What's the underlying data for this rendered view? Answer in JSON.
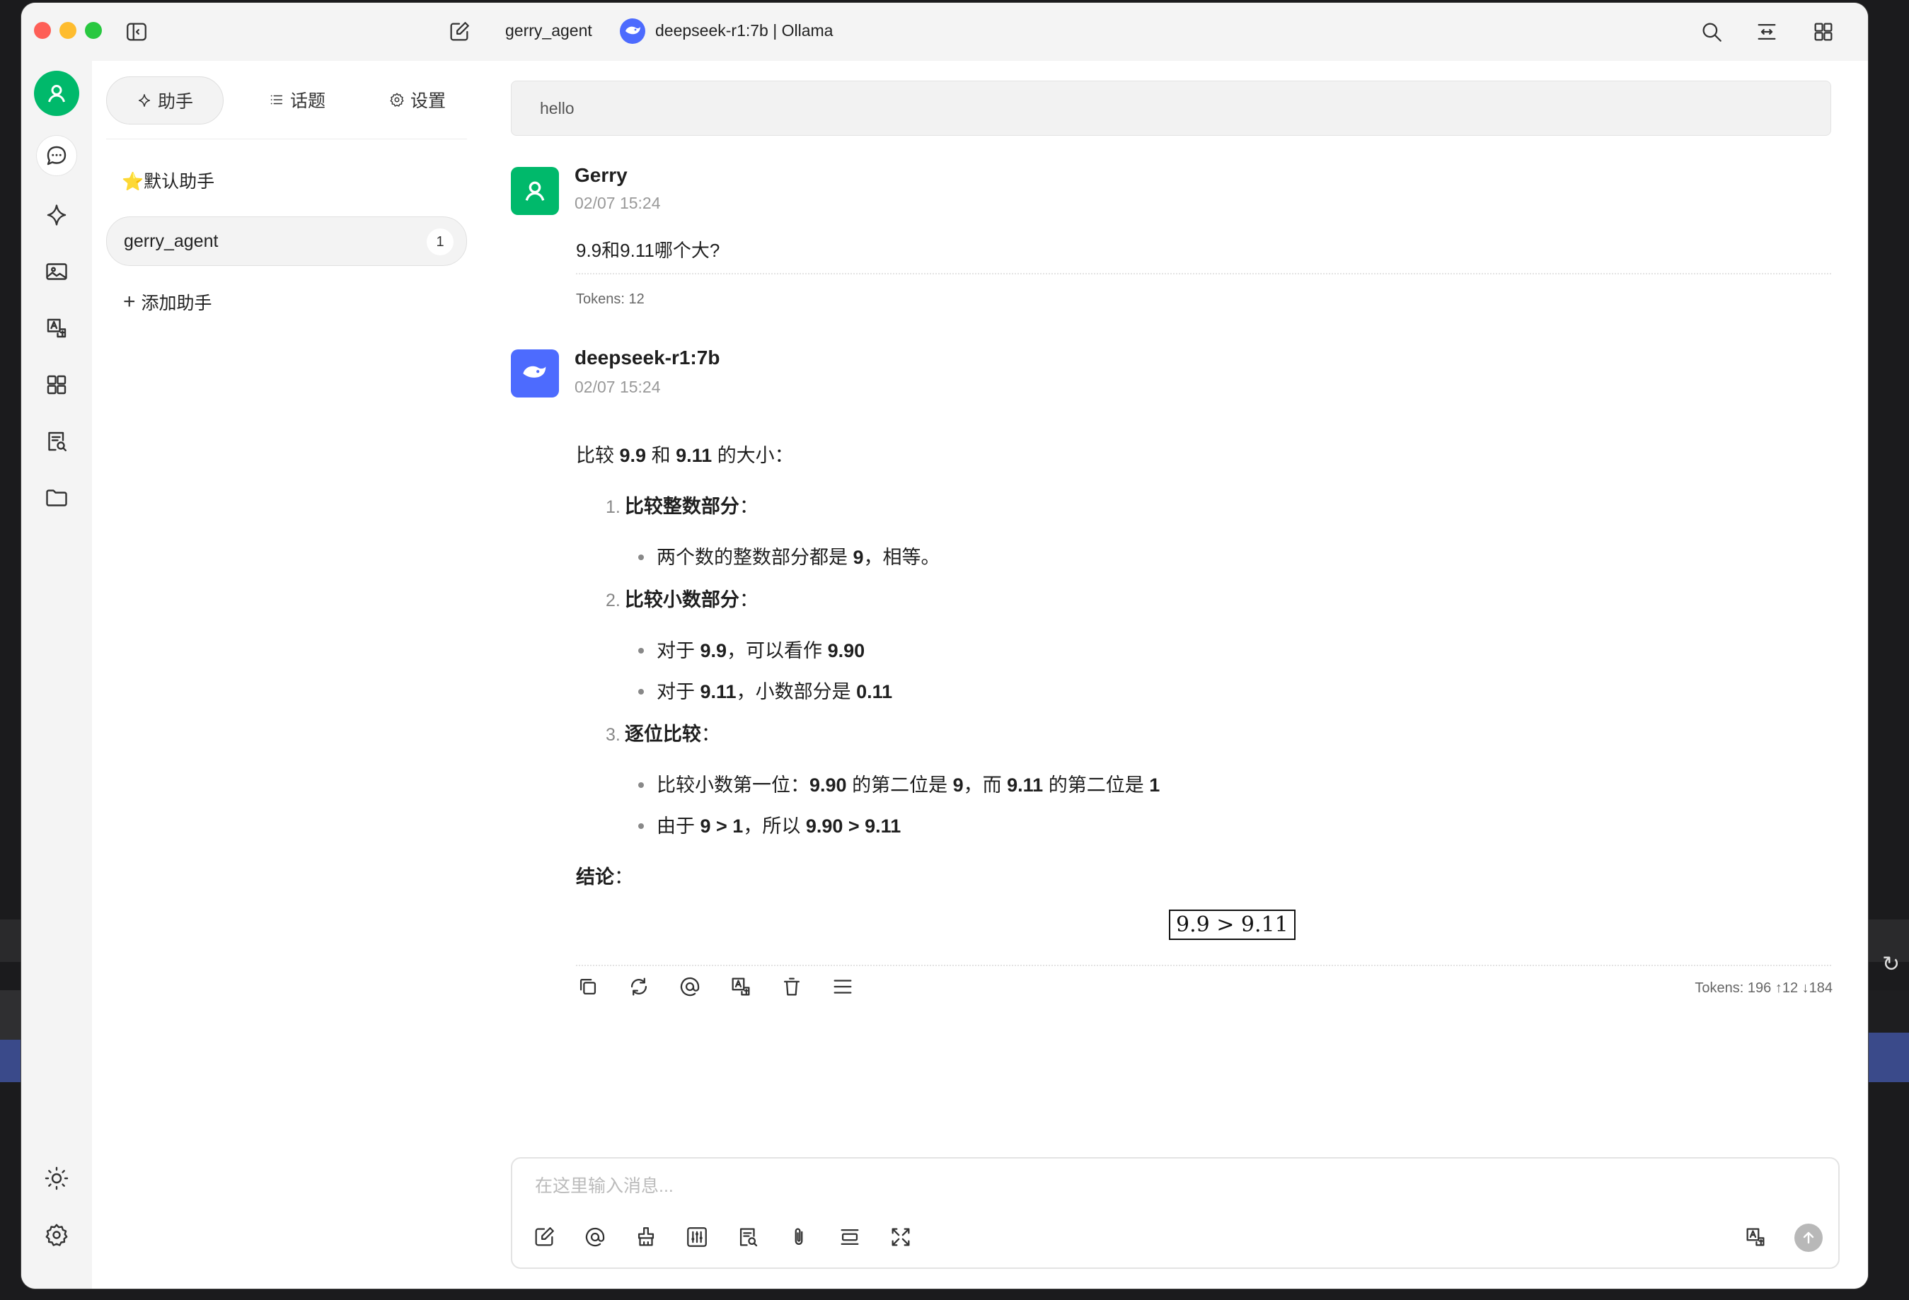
{
  "window": {
    "agent_title": "gerry_agent",
    "model_label": "deepseek-r1:7b | Ollama"
  },
  "left_panel": {
    "tabs": [
      {
        "label": "助手"
      },
      {
        "label": "话题"
      },
      {
        "label": "设置"
      }
    ],
    "assistants": [
      {
        "label": "⭐️默认助手"
      },
      {
        "label": "gerry_agent",
        "count": "1"
      }
    ],
    "add_assistant": "添加助手"
  },
  "chat": {
    "topic": "hello",
    "user_message": {
      "name": "Gerry",
      "time": "02/07 15:24",
      "text": "9.9和9.11哪个大?",
      "tokens": "Tokens: 12"
    },
    "assistant_message": {
      "name": "deepseek-r1:7b",
      "time": "02/07 15:24",
      "intro_pre": "比较 ",
      "intro_a": "9.9",
      "intro_mid": " 和 ",
      "intro_b": "9.11",
      "intro_post": " 的大小：",
      "steps": [
        {
          "num": "1.",
          "title": "比较整数部分",
          "suffix": "："
        },
        {
          "num": "2.",
          "title": "比较小数部分",
          "suffix": "："
        },
        {
          "num": "3.",
          "title": "逐位比较",
          "suffix": "："
        }
      ],
      "step1_bullet": {
        "pre": "两个数的整数部分都是 ",
        "b1": "9",
        "post": "，相等。"
      },
      "step2_bullets": [
        {
          "pre": "对于 ",
          "b1": "9.9",
          "mid": "，可以看作 ",
          "b2": "9.90"
        },
        {
          "pre": "对于 ",
          "b1": "9.11",
          "mid": "，小数部分是 ",
          "b2": "0.11"
        }
      ],
      "step3_bullets": [
        {
          "pre": "比较小数第一位：",
          "b1": "9.90",
          "mid": " 的第二位是 ",
          "b2": "9",
          "mid2": "，而 ",
          "b3": "9.11",
          "mid3": " 的第二位是 ",
          "b4": "1"
        },
        {
          "pre": "由于 ",
          "b1": "9 > 1",
          "mid": "，所以 ",
          "b2": "9.90 > 9.11"
        }
      ],
      "conclusion_label": "结论",
      "conclusion_suffix": "：",
      "formula": "9.9 > 9.11",
      "tokens": "Tokens: 196 ↑12 ↓184"
    }
  },
  "input": {
    "placeholder": "在这里输入消息..."
  },
  "colors": {
    "accent_green": "#00b96b",
    "deepseek_blue": "#4d6bfe"
  }
}
